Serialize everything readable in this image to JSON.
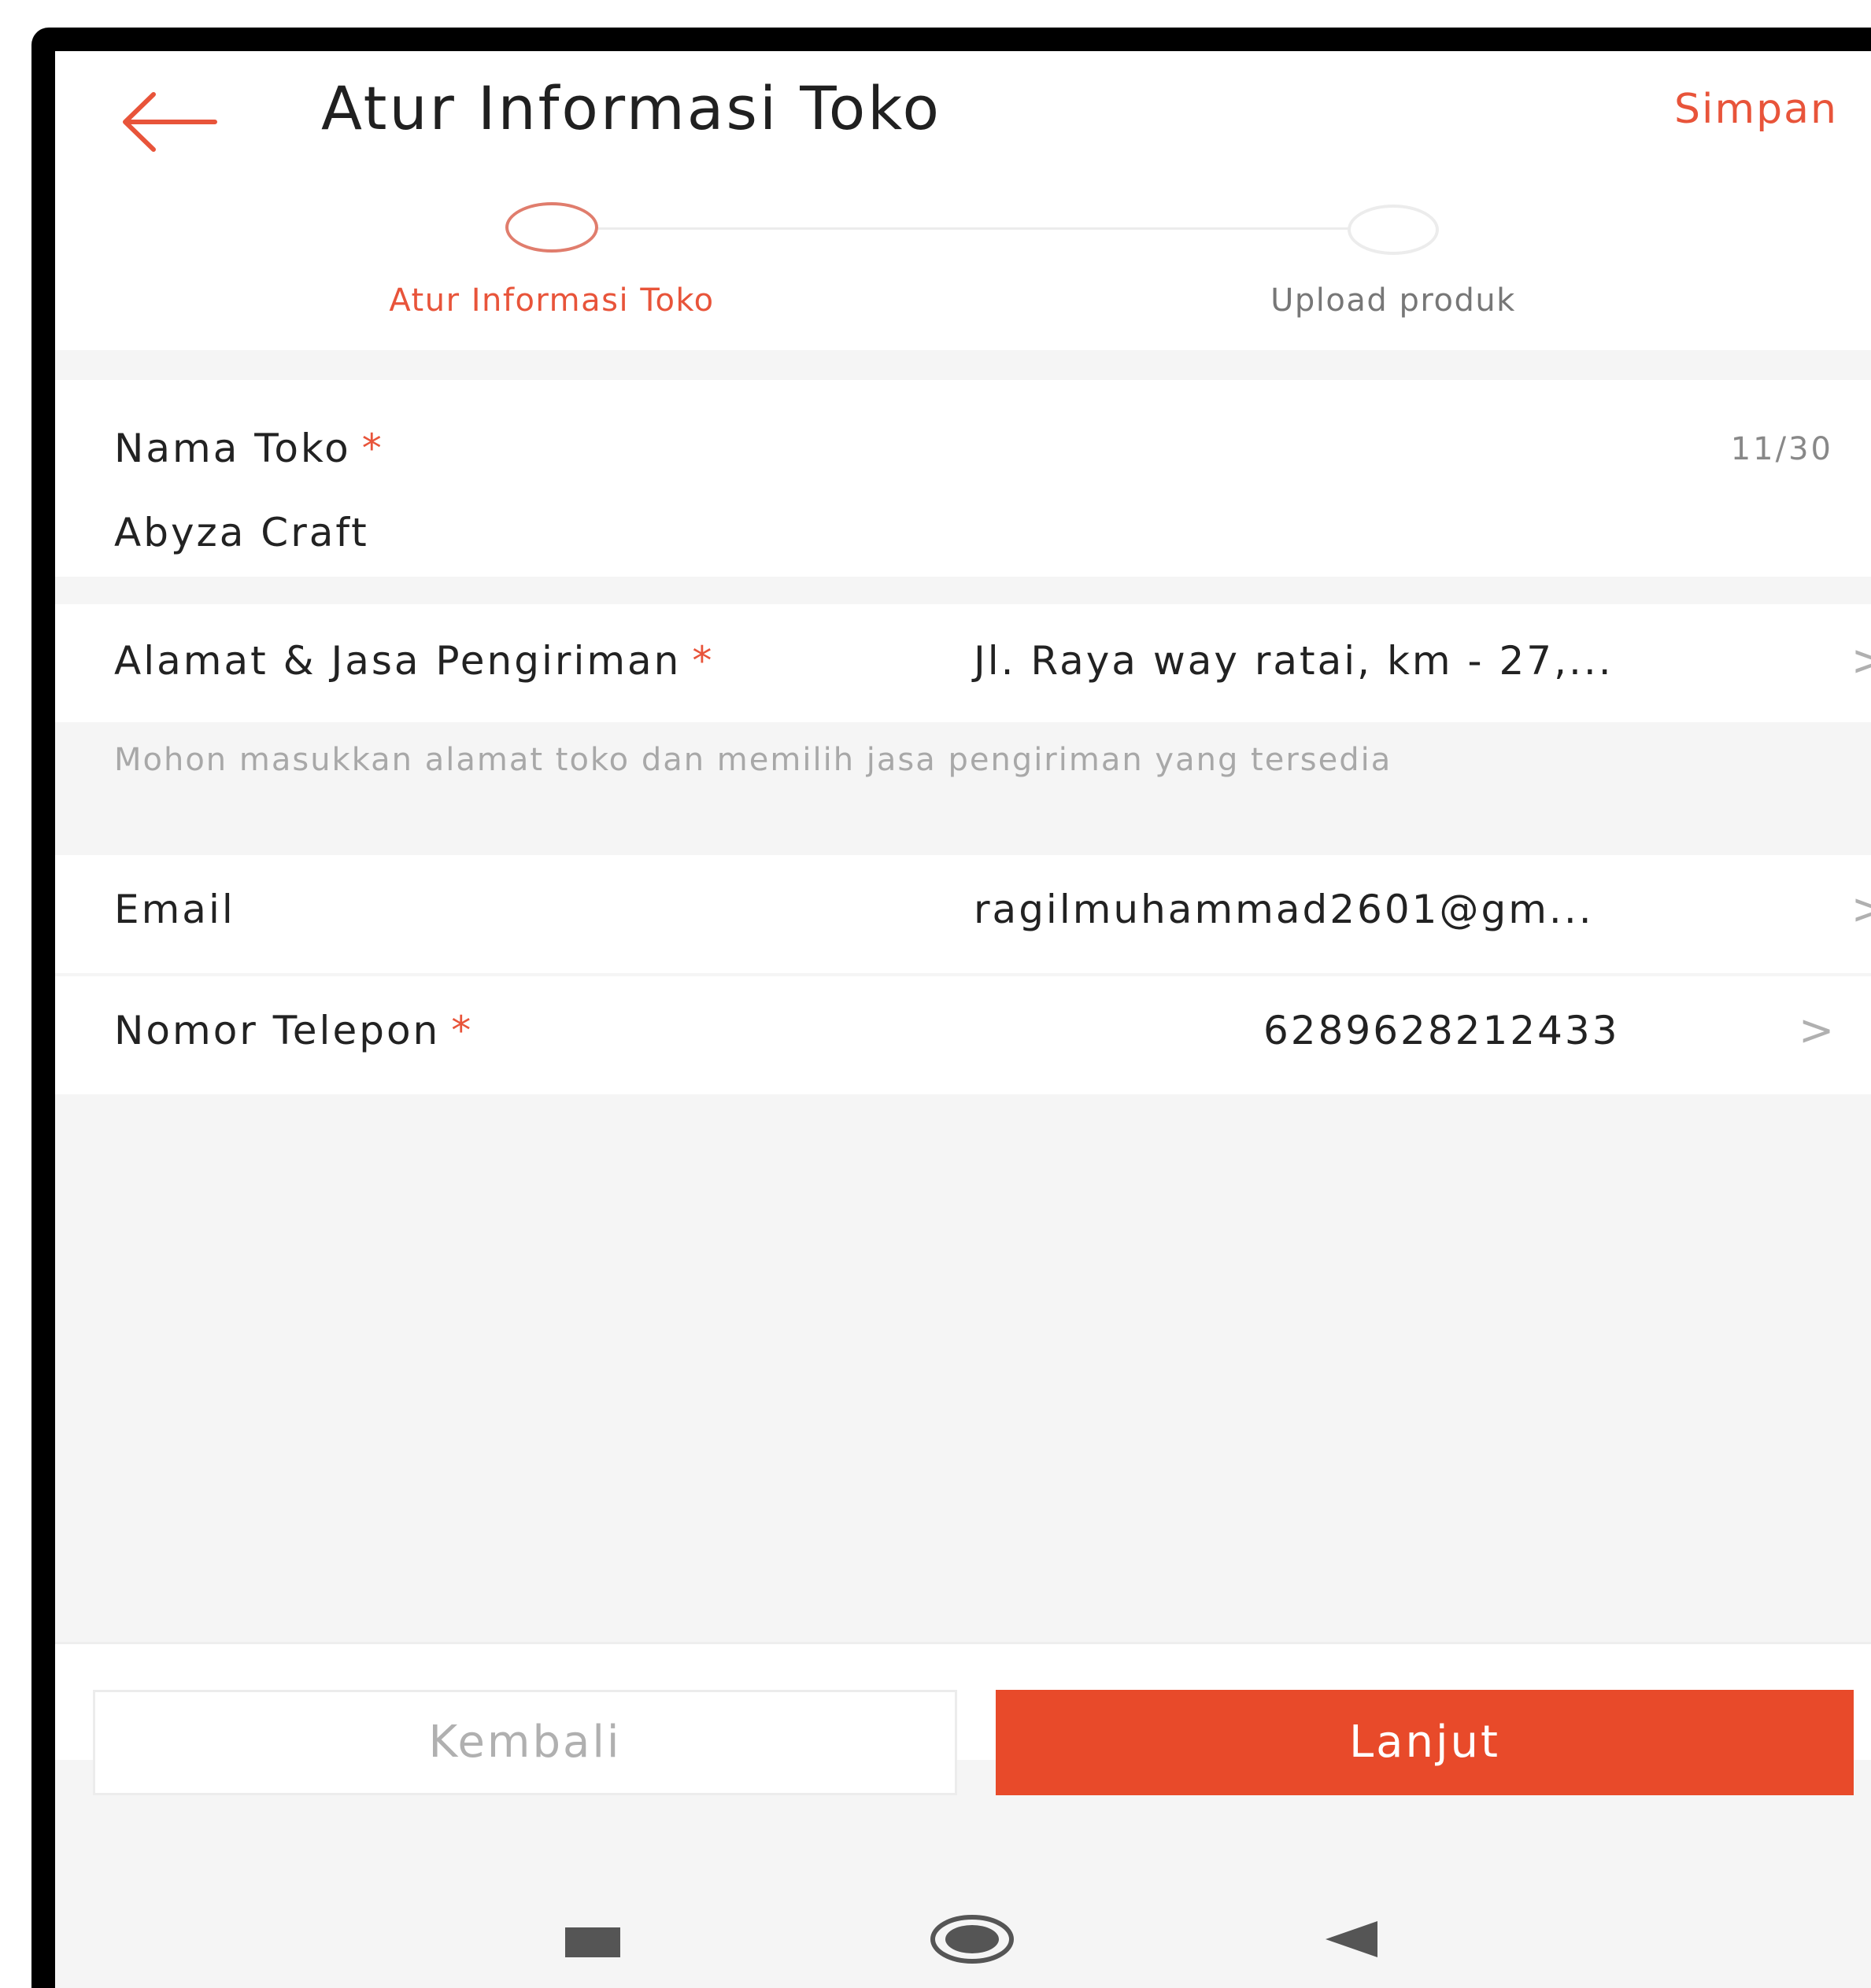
{
  "header": {
    "title": "Atur Informasi Toko",
    "save_label": "Simpan",
    "back_icon": "arrow-left-icon"
  },
  "stepper": {
    "steps": [
      {
        "label": "Atur Informasi Toko",
        "state": "active"
      },
      {
        "label": "Upload produk",
        "state": "inactive"
      }
    ]
  },
  "form": {
    "shop_name": {
      "label": "Nama Toko",
      "required_mark": "*",
      "counter": "11/30",
      "value": "Abyza Craft"
    },
    "address": {
      "label": "Alamat & Jasa Pengiriman",
      "required_mark": "*",
      "value": "Jl. Raya way ratai, km - 27,...",
      "hint": "Mohon masukkan alamat toko dan memilih jasa pengiriman yang tersedia"
    },
    "email": {
      "label": "Email",
      "value": "ragilmuhammad2601@gm..."
    },
    "phone": {
      "label": "Nomor Telepon",
      "required_mark": "*",
      "value": "6289628212433",
      "chevron": ">"
    }
  },
  "footer": {
    "back_label": "Kembali",
    "next_label": "Lanjut"
  },
  "colors": {
    "accent": "#e8543a",
    "primary_button": "#e84a2a",
    "background": "#f5f5f5"
  }
}
